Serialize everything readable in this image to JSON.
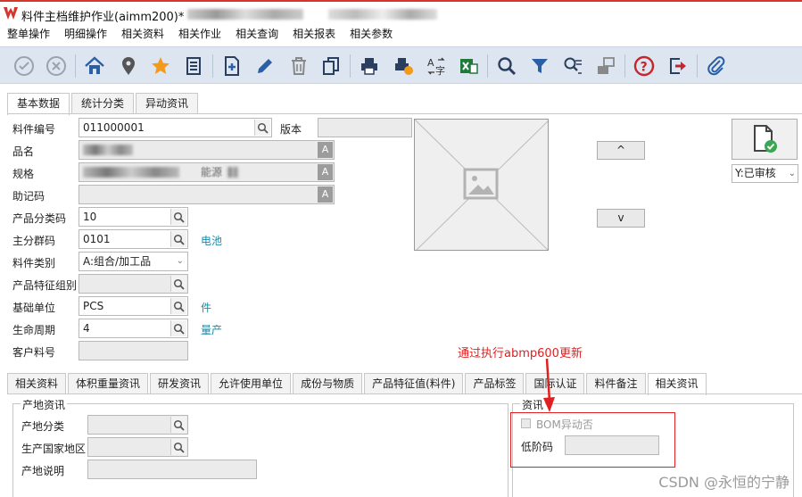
{
  "window": {
    "title": "料件主档维护作业(aimm200)*"
  },
  "menu": {
    "items": [
      "整单操作",
      "明细操作",
      "相关资料",
      "相关作业",
      "相关查询",
      "相关报表",
      "相关参数"
    ]
  },
  "toolbar": {
    "icons": [
      "check-circle-icon",
      "cancel-circle-icon",
      "home-icon",
      "location-pin-icon",
      "star-icon",
      "document-list-icon",
      "add-doc-icon",
      "edit-pencil-icon",
      "delete-trash-icon",
      "copy-icon",
      "print-icon",
      "print-export-icon",
      "translate-icon",
      "excel-export-icon",
      "search-icon",
      "filter-icon",
      "advanced-query-icon",
      "save-disk-icon",
      "help-icon",
      "exit-icon",
      "attachment-icon"
    ]
  },
  "tabs_top": [
    "基本数据",
    "统计分类",
    "异动资讯"
  ],
  "form": {
    "item_no_label": "料件编号",
    "item_no_value": "011000001",
    "version_label": "版本",
    "version_value": "",
    "name_label": "品名",
    "spec_label": "规格",
    "spec_visible_fragment": "能源",
    "mnemonic_label": "助记码",
    "product_class_label": "产品分类码",
    "product_class_value": "10",
    "main_group_label": "主分群码",
    "main_group_value": "0101",
    "main_group_desc": "电池",
    "item_type_label": "料件类别",
    "item_type_value": "A:组合/加工品",
    "feature_group_label": "产品特征组别",
    "base_unit_label": "基础单位",
    "base_unit_value": "PCS",
    "base_unit_desc": "件",
    "lifecycle_label": "生命周期",
    "lifecycle_value": "4",
    "lifecycle_desc": "量产",
    "customer_item_label": "客户料号",
    "a_button": "A"
  },
  "nav": {
    "up": "^",
    "down": "v"
  },
  "status": {
    "value": "Y:已审核",
    "icon": "approved-doc-icon",
    "icon_color": "#3aa853"
  },
  "tabs_bottom": [
    "相关资料",
    "体积重量资讯",
    "研发资讯",
    "允许使用单位",
    "成份与物质",
    "产品特征值(料件)",
    "产品标签",
    "国际认证",
    "料件备注",
    "相关资讯"
  ],
  "origin_group": {
    "title": "产地资讯",
    "origin_class_label": "产地分类",
    "country_label": "生产国家地区",
    "origin_desc_label": "产地说明"
  },
  "info_group": {
    "title": "资讯",
    "bom_label": "BOM异动否",
    "low_level_label": "低阶码"
  },
  "annotation": {
    "text": "通过执行abmp600更新",
    "color": "#e02020"
  },
  "watermark": "CSDN @永恒的宁静"
}
